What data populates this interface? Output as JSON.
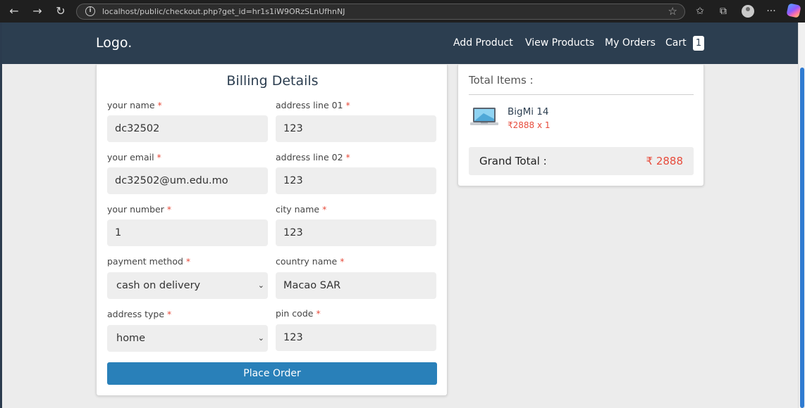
{
  "browser": {
    "url": "localhost/public/checkout.php?get_id=hr1s1iW9ORzSLnUfhnNJ"
  },
  "header": {
    "logo": "Logo.",
    "nav": [
      "Add Product",
      "View Products",
      "My Orders",
      "Cart"
    ],
    "cart_count": "1"
  },
  "billing": {
    "title": "Billing Details",
    "required_mark": "*",
    "fields": {
      "name": {
        "label": "your name",
        "value": "dc32502"
      },
      "address1": {
        "label": "address line 01",
        "value": "123"
      },
      "email": {
        "label": "your email",
        "value": "dc32502@um.edu.mo"
      },
      "address2": {
        "label": "address line 02",
        "value": "123"
      },
      "number": {
        "label": "your number",
        "value": "1"
      },
      "city": {
        "label": "city name",
        "value": "123"
      },
      "payment": {
        "label": "payment method",
        "value": "cash on delivery"
      },
      "country": {
        "label": "country name",
        "value": "Macao SAR"
      },
      "address_type": {
        "label": "address type",
        "value": "home"
      },
      "pin": {
        "label": "pin code",
        "value": "123"
      }
    },
    "place_order": "Place Order"
  },
  "summary": {
    "total_items_label": "Total Items :",
    "item": {
      "name": "BigMi 14",
      "price": "2888 x 1",
      "currency": "₹"
    },
    "grand_total_label": "Grand Total :",
    "grand_total_value": "2888"
  },
  "colors": {
    "header_bg": "#2c3e50",
    "button_bg": "#2980b9",
    "price_red": "#e74c3c"
  },
  "icons": [
    "back-icon",
    "forward-icon",
    "reload-icon",
    "info-icon",
    "star-icon",
    "favorites-icon",
    "extensions-icon",
    "profile-icon",
    "more-icon",
    "copilot-icon",
    "chevron-down-icon",
    "laptop-thumbnail"
  ]
}
